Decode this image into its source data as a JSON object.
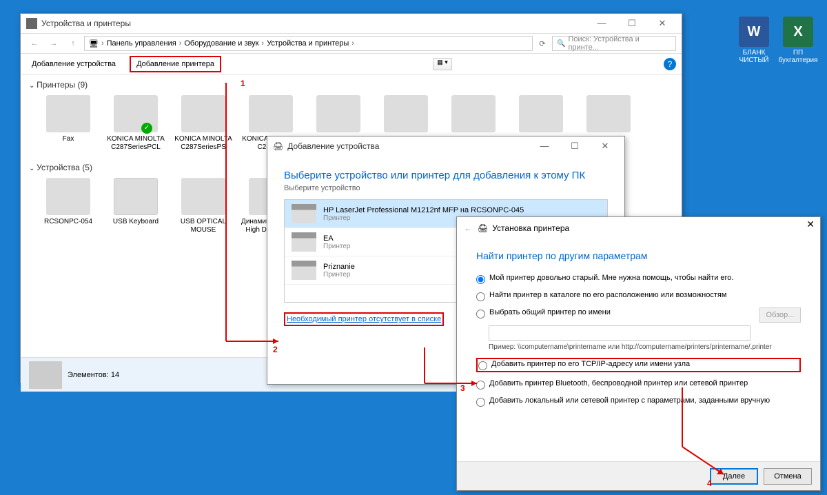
{
  "explorer": {
    "title": "Устройства и принтеры",
    "breadcrumb": [
      "Панель управления",
      "Оборудование и звук",
      "Устройства и принтеры"
    ],
    "search_placeholder": "Поиск: Устройства и принте...",
    "toolbar": {
      "add_device": "Добавление устройства",
      "add_printer": "Добавление принтера"
    },
    "sections": {
      "printers": "Принтеры (9)",
      "devices": "Устройства (5)"
    },
    "printers": [
      {
        "name": "Fax"
      },
      {
        "name": "KONICA MINOLTA C287SeriesPCL",
        "default": true
      },
      {
        "name": "KONICA MINOLTA C287SeriesPS"
      },
      {
        "name": "KONICA MINOLTA C287S..."
      },
      {
        "name": ""
      },
      {
        "name": ""
      },
      {
        "name": ""
      },
      {
        "name": ""
      },
      {
        "name": ""
      }
    ],
    "devices": [
      {
        "name": "RCSONPC-054"
      },
      {
        "name": "USB Keyboard"
      },
      {
        "name": "USB OPTICAL MOUSE"
      },
      {
        "name": "Динамики (Realtek High Definition..."
      },
      {
        "name": ""
      }
    ],
    "status": "Элементов: 14"
  },
  "wizard1": {
    "title": "Добавление устройства",
    "heading": "Выберите устройство или принтер для добавления к этому ПК",
    "sub": "Выберите устройство",
    "items": [
      {
        "name": "HP LaserJet Professional M1212nf MFP на RCSONPC-045",
        "type": "Принтер"
      },
      {
        "name": "EA",
        "type": "Принтер"
      },
      {
        "name": "Priznanie",
        "type": "Принтер"
      }
    ],
    "link": "Необходимый принтер отсутствует в списке"
  },
  "wizard2": {
    "title": "Установка принтера",
    "heading": "Найти принтер по другим параметрам",
    "options": [
      "Мой принтер довольно старый. Мне нужна помощь, чтобы найти его.",
      "Найти принтер в каталоге по его расположению или возможностям",
      "Выбрать общий принтер по имени",
      "Добавить принтер по его TCP/IP-адресу или имени узла",
      "Добавить принтер Bluetooth, беспроводной принтер или сетевой принтер",
      "Добавить локальный или сетевой принтер с параметрами, заданными вручную"
    ],
    "browse": "Обзор...",
    "example": "Пример: \\\\computername\\printername или http://computername/printers/printername/.printer",
    "next": "Далее",
    "cancel": "Отмена"
  },
  "desktop": [
    {
      "label": "БЛАНК ЧИСТЫЙ",
      "type": "word"
    },
    {
      "label": "ПП бухгалтерия",
      "type": "excel"
    }
  ],
  "annotations": {
    "n1": "1",
    "n2": "2",
    "n3": "3",
    "n4": "4"
  }
}
